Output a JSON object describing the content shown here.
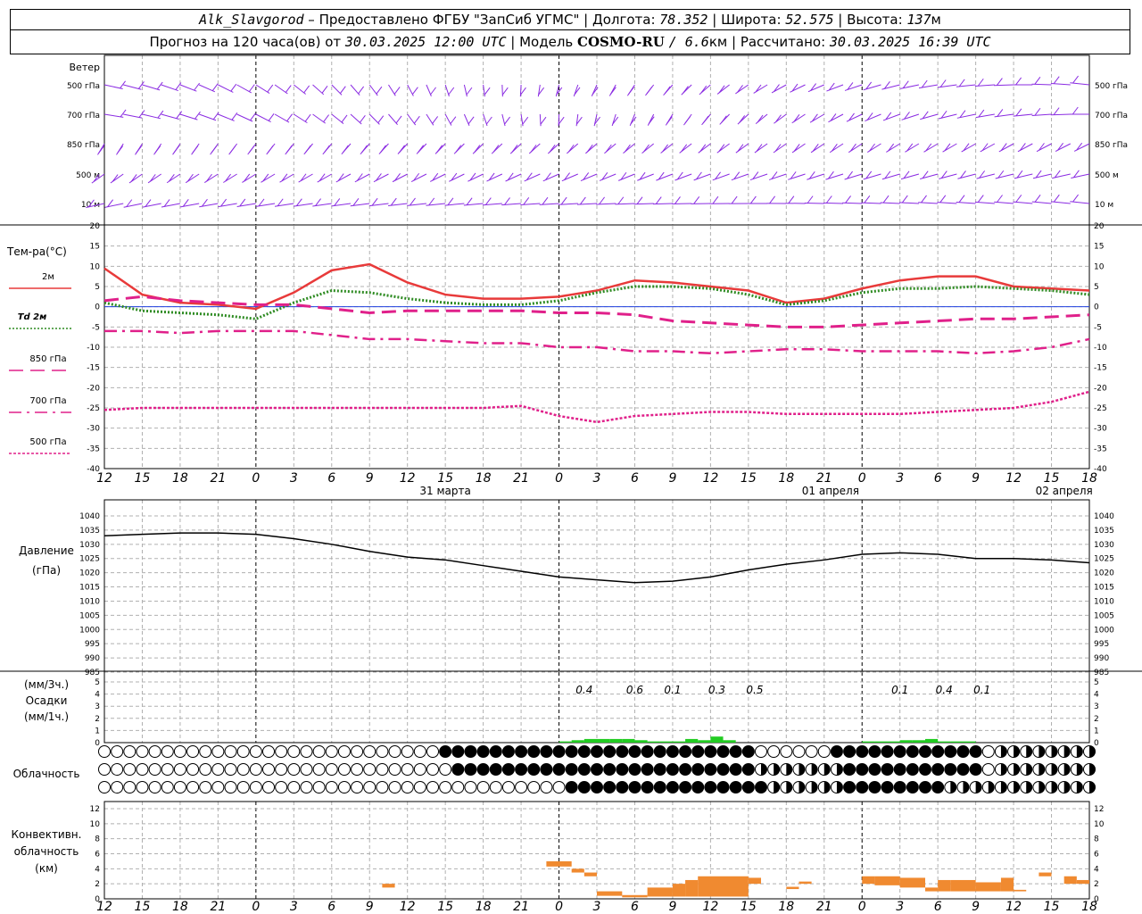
{
  "header": {
    "station": "Alk_Slavgorod",
    "dash": " – ",
    "provided": "Предоставлено ФГБУ \"ЗапСиб УГМС\"",
    "lon_label": "Долгота:",
    "lon": "78.352",
    "lat_label": "Широта:",
    "lat": "52.575",
    "alt_label": "Высота:",
    "alt": "137",
    "alt_unit": "м",
    "forecast_label": "Прогноз на 120 часа(ов) от",
    "forecast_time": "30.03.2025 12:00 UTC",
    "model_label": "Модель",
    "model": "COSMO-RU",
    "model_res": "/ 6.6",
    "model_res_unit": "км",
    "calc_label": "Рассчитано:",
    "calc_time": "30.03.2025 16:39 UTC"
  },
  "wind": {
    "title": "Ветер",
    "levels": [
      "500 гПа",
      "700 гПа",
      "850 гПа",
      "500 м",
      "10 м"
    ],
    "color": "#8a2be2"
  },
  "temperature": {
    "title": "Тем-ра(°C)",
    "legend": [
      {
        "label": "2м",
        "color": "#e83a3a",
        "style": "solid"
      },
      {
        "label": "Td 2м",
        "color": "#2e8b22",
        "style": "dotted"
      },
      {
        "label": "850 гПа",
        "color": "#e0208a",
        "style": "dash"
      },
      {
        "label": "700 гПа",
        "color": "#e0208a",
        "style": "dashdot"
      },
      {
        "label": "500 гПа",
        "color": "#e0208a",
        "style": "fine"
      }
    ],
    "y_ticks": [
      "20",
      "15",
      "10",
      "5",
      "0",
      "-5",
      "-10",
      "-15",
      "-20",
      "-25",
      "-30",
      "-35",
      "-40"
    ]
  },
  "time_axis": {
    "hour_labels": [
      "12",
      "15",
      "18",
      "21",
      "0",
      "3",
      "6",
      "9",
      "12",
      "15",
      "18",
      "21",
      "0",
      "3",
      "6",
      "9",
      "12",
      "15",
      "18",
      "21",
      "0",
      "3",
      "6",
      "9",
      "12",
      "15",
      "18"
    ],
    "date_labels": [
      "31 марта",
      "01 апреля",
      "02 апреля"
    ]
  },
  "pressure": {
    "title": "Давление",
    "unit": "(гПа)",
    "y_ticks": [
      "1040",
      "1035",
      "1030",
      "1025",
      "1020",
      "1015",
      "1010",
      "1005",
      "1000",
      "995",
      "990",
      "985"
    ]
  },
  "precip": {
    "title_line1": "(мм/3ч.)",
    "title_line2": "Осадки",
    "title_line3": "(мм/1ч.)",
    "y_ticks": [
      "5",
      "4",
      "3",
      "2",
      "1",
      "0"
    ],
    "labels": [
      "0.4",
      "0.6",
      "0.1",
      "0.3",
      "0.5",
      "0.1",
      "0.4",
      "0.1"
    ],
    "color": "#22cc22"
  },
  "clouds": {
    "title": "Облачность"
  },
  "convective": {
    "title_line1": "Конвективн.",
    "title_line2": "облачность",
    "title_line3": "(км)",
    "y_ticks": [
      "12",
      "10",
      "8",
      "6",
      "4",
      "2",
      "0"
    ],
    "color": "#f08a30"
  },
  "chart_data": [
    {
      "type": "line",
      "title": "Тем-ра(°C)",
      "x_hours": [
        0,
        3,
        6,
        9,
        12,
        15,
        18,
        21,
        24,
        27,
        30,
        33,
        36,
        39,
        42,
        45,
        48,
        51,
        54,
        57,
        60,
        63,
        66,
        69,
        72,
        75,
        78
      ],
      "ylim": [
        -40,
        20
      ],
      "series": [
        {
          "name": "2м",
          "values": [
            9.5,
            3,
            1,
            0.5,
            -0.5,
            3.5,
            9,
            10.5,
            6,
            3,
            2,
            2,
            2.5,
            4,
            6.5,
            6,
            5,
            4,
            1,
            2,
            4.5,
            6.5,
            7.5,
            7.5,
            5,
            4.5,
            4
          ]
        },
        {
          "name": "Td 2м",
          "values": [
            1,
            -1,
            -1.5,
            -2,
            -3,
            1,
            4,
            3.5,
            2,
            1,
            0.5,
            0.5,
            1.5,
            3.5,
            5,
            5,
            4.5,
            3,
            0.5,
            1.5,
            3.5,
            4.5,
            4.5,
            5,
            4.5,
            4,
            3
          ]
        },
        {
          "name": "850 гПа",
          "values": [
            1.5,
            2.5,
            1.5,
            1,
            0.5,
            0.5,
            -0.5,
            -1.5,
            -1,
            -1,
            -1,
            -1,
            -1.5,
            -1.5,
            -2,
            -3.5,
            -4,
            -4.5,
            -5,
            -5,
            -4.5,
            -4,
            -3.5,
            -3,
            -3,
            -2.5,
            -2
          ]
        },
        {
          "name": "700 гПа",
          "values": [
            -6,
            -6,
            -6.5,
            -6,
            -6,
            -6,
            -7,
            -8,
            -8,
            -8.5,
            -9,
            -9,
            -10,
            -10,
            -11,
            -11,
            -11.5,
            -11,
            -10.5,
            -10.5,
            -11,
            -11,
            -11,
            -11.5,
            -11,
            -10,
            -8
          ]
        },
        {
          "name": "500 гПа",
          "values": [
            -25.5,
            -25,
            -25,
            -25,
            -25,
            -25,
            -25,
            -25,
            -25,
            -25,
            -25,
            -24.5,
            -27,
            -28.5,
            -27,
            -26.5,
            -26,
            -26,
            -26.5,
            -26.5,
            -26.5,
            -26.5,
            -26,
            -25.5,
            -25,
            -23.5,
            -21
          ]
        }
      ]
    },
    {
      "type": "line",
      "title": "Давление",
      "ylabel": "(гПа)",
      "x_hours": [
        0,
        3,
        6,
        9,
        12,
        15,
        18,
        21,
        24,
        27,
        30,
        33,
        36,
        39,
        42,
        45,
        48,
        51,
        54,
        57,
        60,
        63,
        66,
        69,
        72,
        75,
        78
      ],
      "ylim": [
        985,
        1040
      ],
      "series": [
        {
          "name": "Давление",
          "values": [
            1033,
            1033.5,
            1034,
            1034,
            1033.5,
            1032,
            1030,
            1027.5,
            1025.5,
            1024.5,
            1022.5,
            1020.5,
            1018.5,
            1017.5,
            1016.5,
            1017,
            1018.5,
            1021,
            1023,
            1024.5,
            1026.5,
            1027,
            1026.5,
            1025,
            1025,
            1024.5,
            1023.5
          ]
        }
      ]
    },
    {
      "type": "bar",
      "title": "Осадки",
      "ylabel": "(мм/1ч.)",
      "ylim": [
        0,
        5
      ],
      "x_hours": [
        36,
        37,
        38,
        39,
        40,
        41,
        42,
        43,
        44,
        45,
        46,
        47,
        48,
        49,
        60,
        61,
        62,
        63,
        64,
        65,
        66,
        67,
        68
      ],
      "values": [
        0.1,
        0.2,
        0.3,
        0.3,
        0.3,
        0.3,
        0.2,
        0.1,
        0.1,
        0.1,
        0.3,
        0.2,
        0.5,
        0.2,
        0.1,
        0.1,
        0.1,
        0.2,
        0.2,
        0.3,
        0.1,
        0.1,
        0.1
      ]
    },
    {
      "type": "bar",
      "title": "Конвективн. облачность",
      "ylabel": "(км)",
      "ylim": [
        0,
        13
      ],
      "segments": [
        {
          "x0": 22,
          "x1": 23,
          "bottom": 1.5,
          "top": 2
        },
        {
          "x0": 35,
          "x1": 37,
          "bottom": 4.3,
          "top": 5
        },
        {
          "x0": 37,
          "x1": 38,
          "bottom": 3.5,
          "top": 4
        },
        {
          "x0": 38,
          "x1": 39,
          "bottom": 3,
          "top": 3.5
        },
        {
          "x0": 39,
          "x1": 41,
          "bottom": 0.4,
          "top": 1
        },
        {
          "x0": 41,
          "x1": 43,
          "bottom": 0.2,
          "top": 0.5
        },
        {
          "x0": 43,
          "x1": 45,
          "bottom": 0.3,
          "top": 1.5
        },
        {
          "x0": 45,
          "x1": 46,
          "bottom": 0.3,
          "top": 2
        },
        {
          "x0": 46,
          "x1": 47,
          "bottom": 0.3,
          "top": 2.5
        },
        {
          "x0": 47,
          "x1": 51,
          "bottom": 0.3,
          "top": 3
        },
        {
          "x0": 51,
          "x1": 52,
          "bottom": 2,
          "top": 2.8
        },
        {
          "x0": 54,
          "x1": 55,
          "bottom": 1.3,
          "top": 1.6
        },
        {
          "x0": 55,
          "x1": 56,
          "bottom": 2,
          "top": 2.3
        },
        {
          "x0": 60,
          "x1": 61,
          "bottom": 2,
          "top": 3
        },
        {
          "x0": 61,
          "x1": 63,
          "bottom": 1.8,
          "top": 3
        },
        {
          "x0": 63,
          "x1": 65,
          "bottom": 1.5,
          "top": 2.8
        },
        {
          "x0": 65,
          "x1": 66,
          "bottom": 1,
          "top": 1.5
        },
        {
          "x0": 66,
          "x1": 67,
          "bottom": 1,
          "top": 2.5
        },
        {
          "x0": 67,
          "x1": 69,
          "bottom": 1,
          "top": 2.5
        },
        {
          "x0": 69,
          "x1": 71,
          "bottom": 1,
          "top": 2.2
        },
        {
          "x0": 71,
          "x1": 72,
          "bottom": 1,
          "top": 2.8
        },
        {
          "x0": 72,
          "x1": 73,
          "bottom": 1,
          "top": 1.2
        },
        {
          "x0": 74,
          "x1": 75,
          "bottom": 3,
          "top": 3.5
        },
        {
          "x0": 76,
          "x1": 77,
          "bottom": 2,
          "top": 3
        },
        {
          "x0": 77,
          "x1": 78,
          "bottom": 2,
          "top": 2.5
        }
      ]
    }
  ]
}
